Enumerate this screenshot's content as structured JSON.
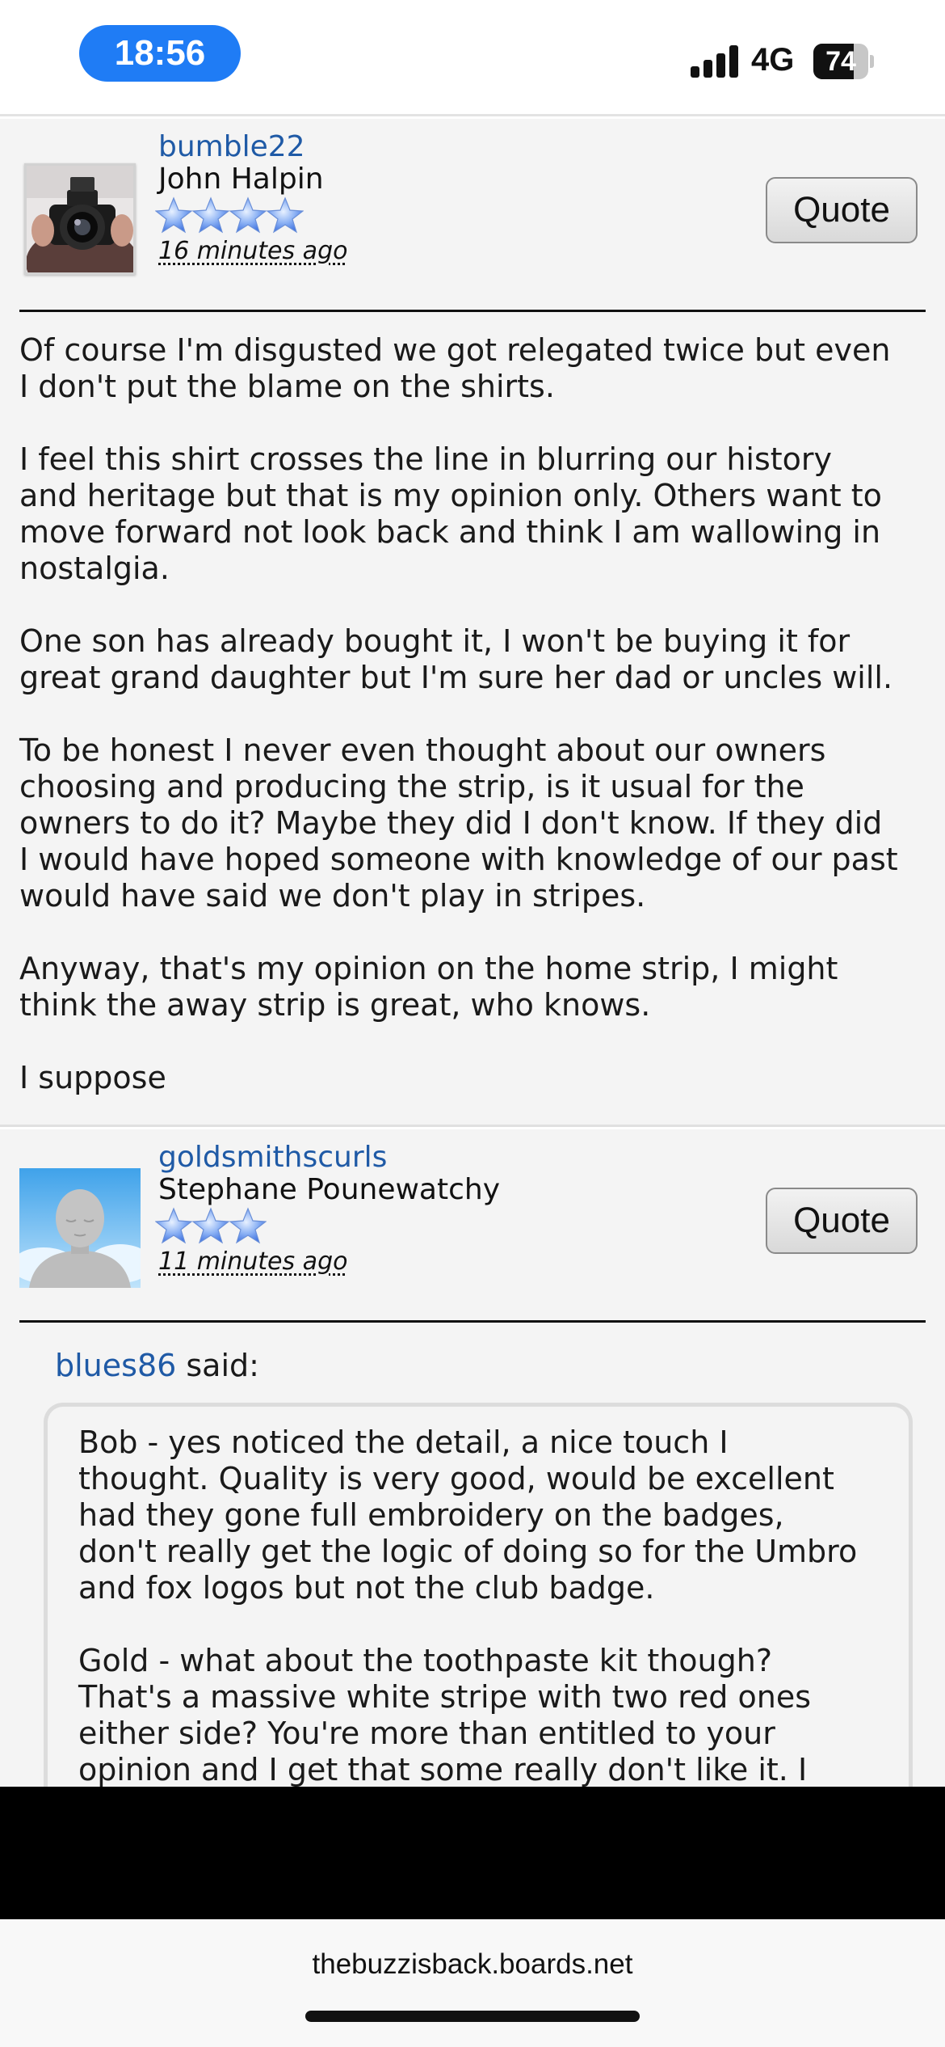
{
  "status_bar": {
    "time": "18:56",
    "network": "4G",
    "battery_level": "74",
    "battery_fraction": 0.74
  },
  "posts": [
    {
      "username": "bumble22",
      "display_name": "John Halpin",
      "stars": 4,
      "time_ago": "16 minutes ago",
      "quote_label": "Quote",
      "paragraphs": [
        "Of course I'm disgusted we got relegated twice but even\nI don't put the blame on the shirts.",
        "I feel this shirt crosses the line in blurring our history\nand heritage but that is my opinion only. Others want to\nmove forward not look back and think I am wallowing in\nnostalgia.",
        "One son has already bought it, I won't be buying it for\ngreat grand daughter but I'm sure her dad or uncles will.",
        "To be honest I never even thought about our owners\nchoosing and producing the strip, is it usual for the\nowners to do it? Maybe they did I don't know. If they did\nI would have hoped someone with knowledge of our past\nwould have said we don't play in stripes.",
        "Anyway, that's my opinion on the home strip, I might\nthink the away strip is great, who knows.",
        "I suppose"
      ]
    },
    {
      "username": "goldsmithscurls",
      "display_name": "Stephane Pounewatchy",
      "stars": 3,
      "time_ago": "11 minutes ago",
      "quote_label": "Quote",
      "quoted_user": "blues86",
      "quoted_said": " said:",
      "quoted_paragraphs": [
        "Bob - yes noticed the detail, a nice touch I\nthought. Quality is very good, would be excellent\nhad they gone full embroidery on the badges,\ndon't really get the logic of doing so for the Umbro\nand fox logos but not the club badge.",
        "Gold - what about the toothpaste kit though?\nThat's a massive white stripe with two red ones\neither side? You're more than entitled to your\nopinion and I get that some really don't like it. I"
      ]
    }
  ],
  "browser": {
    "url": "thebuzzisback.boards.net"
  }
}
